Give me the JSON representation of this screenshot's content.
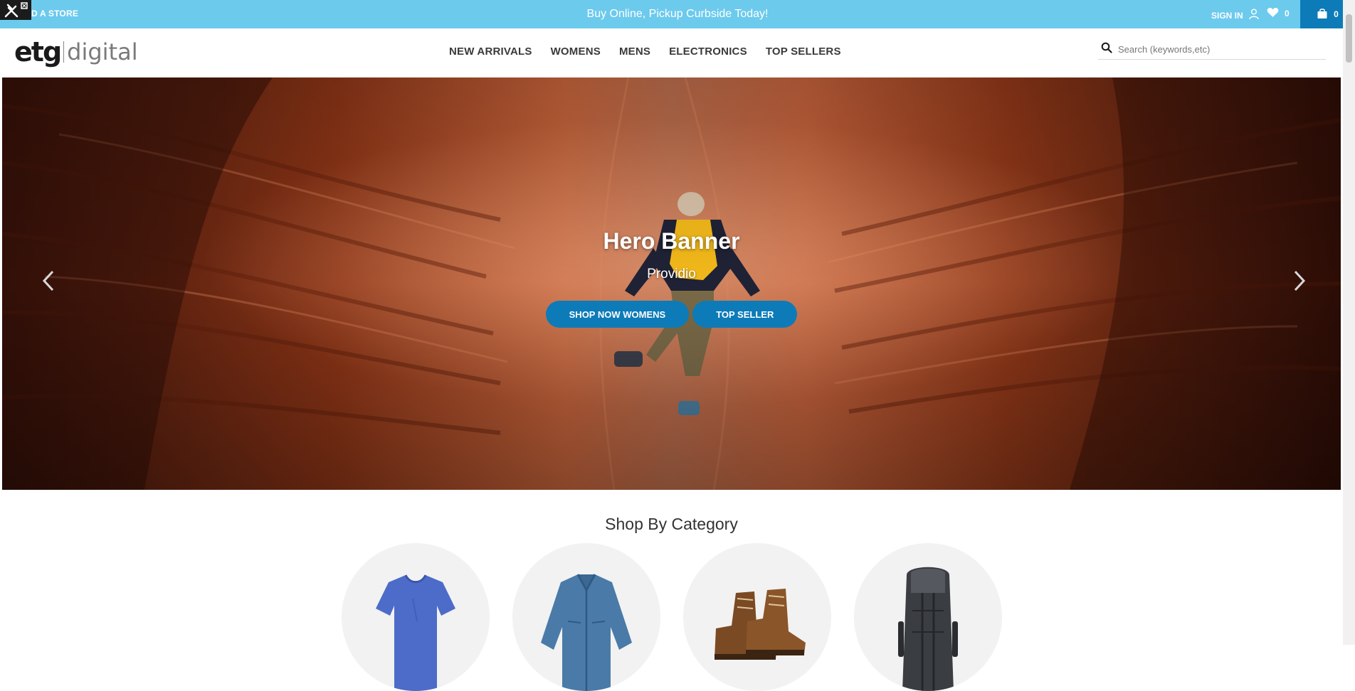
{
  "topbar": {
    "find_store": "D A STORE",
    "promo": "Buy Online, Pickup Curbside Today!",
    "sign_in": "SIGN IN",
    "wishlist_count": "0",
    "cart_count": "0"
  },
  "header": {
    "logo_left": "etg",
    "logo_right": "digital",
    "nav": [
      "NEW ARRIVALS",
      "WOMENS",
      "MENS",
      "ELECTRONICS",
      "TOP SELLERS"
    ],
    "search_placeholder": "Search (keywords,etc)"
  },
  "hero": {
    "title": "Hero Banner",
    "subtitle": "Providio",
    "buttons": [
      "SHOP NOW WOMENS",
      "TOP SELLER"
    ]
  },
  "categories": {
    "title": "Shop By Category",
    "items": [
      "t-shirt",
      "jacket",
      "boots",
      "backpack"
    ]
  },
  "colors": {
    "promo_bar": "#6ccaed",
    "accent": "#0d7bb8"
  }
}
